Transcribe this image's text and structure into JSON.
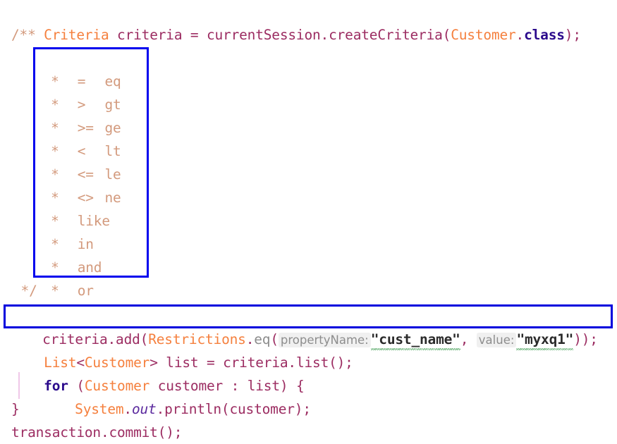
{
  "editor": {
    "language": "java",
    "background_color": "#ffffff",
    "font_size_px": 19.5,
    "line_height_px": 33
  },
  "colors": {
    "class_name": "#f5803e",
    "identifier": "#9c2d62",
    "keyword": "#2b0a8c",
    "static_field": "#5b2a9e",
    "comment": "#d39a7d",
    "method_call": "#8d8d8d",
    "string_literal": "#2b2b2b",
    "annotation_box": "#0000ee",
    "hint_background": "#f0f0f0",
    "hint_text": "#8d8d8d",
    "indent_guide": "#f0c8e8",
    "spellcheck_squiggle": "#3c9b4f"
  },
  "code": {
    "line1": {
      "class_type": "Criteria",
      "var_name": " criteria = currentSession",
      "dot1": ".",
      "method": "createCriteria(",
      "arg_class": "Customer",
      "dot2": ".",
      "keyword_class": "class",
      "tail": ");"
    },
    "comment_open": "/**",
    "comment_close": " */",
    "comment_star": "*",
    "comment_rows": [
      {
        "symbol": "=",
        "name": "eq"
      },
      {
        "symbol": ">",
        "name": "gt"
      },
      {
        "symbol": ">=",
        "name": "ge"
      },
      {
        "symbol": "<",
        "name": "lt"
      },
      {
        "symbol": "<=",
        "name": "le"
      },
      {
        "symbol": "<>",
        "name": "ne"
      },
      {
        "symbol": "",
        "name": "like"
      },
      {
        "symbol": "",
        "name": "in"
      },
      {
        "symbol": "",
        "name": "and"
      },
      {
        "symbol": "",
        "name": "or"
      }
    ],
    "restriction_line": {
      "prefix": "criteria.add(",
      "class_name": "Restrictions",
      "dot": ".",
      "method": "eq",
      "open_paren": "(",
      "hint_property": "propertyName:",
      "string_property": "\"cust_name\"",
      "comma": ", ",
      "hint_value": "value:",
      "string_value": "\"myxq1\"",
      "suffix": "));"
    },
    "list_line": {
      "type": "List",
      "lt": "<",
      "generic": "Customer",
      "gt": ">",
      "rest": " list = criteria.list();"
    },
    "for_line": {
      "keyword": "for",
      "open": " (",
      "type": "Customer",
      "rest": " customer : list) {"
    },
    "println_line": {
      "system": "System",
      "dot1": ".",
      "out": "out",
      "dot2": ".",
      "rest": "println(customer);"
    },
    "close_brace": "}",
    "commit_line": "transaction.commit();"
  },
  "annotations": {
    "operator_box_label": "operator-reference-box",
    "restriction_box_label": "restriction-highlight-box"
  }
}
